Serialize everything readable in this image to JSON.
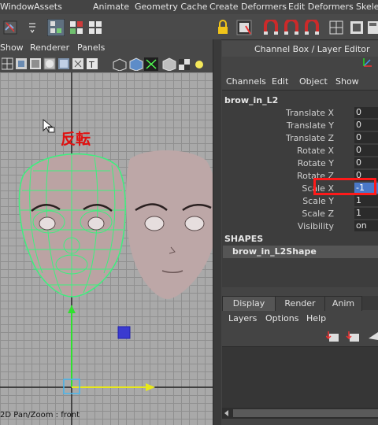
{
  "menubar": {
    "items": [
      "Window",
      "Assets",
      "Animate",
      "Geometry Cache",
      "Create Deformers",
      "Edit Deformers",
      "Skelet"
    ]
  },
  "viewport": {
    "menu": [
      "Show",
      "Renderer",
      "Panels"
    ],
    "annotation": "反転",
    "status": "2D Pan/Zoom : front"
  },
  "channel_box": {
    "title": "Channel Box / Layer Editor",
    "menu": [
      "Channels",
      "Edit",
      "Object",
      "Show"
    ],
    "object_name": "brow_in_L2",
    "attributes": [
      {
        "label": "Translate X",
        "value": "0"
      },
      {
        "label": "Translate Y",
        "value": "0"
      },
      {
        "label": "Translate Z",
        "value": "0"
      },
      {
        "label": "Rotate X",
        "value": "0"
      },
      {
        "label": "Rotate Y",
        "value": "0"
      },
      {
        "label": "Rotate Z",
        "value": "0"
      },
      {
        "label": "Scale X",
        "value": "-1"
      },
      {
        "label": "Scale Y",
        "value": "1"
      },
      {
        "label": "Scale Z",
        "value": "1"
      },
      {
        "label": "Visibility",
        "value": "on"
      }
    ],
    "shapes_label": "SHAPES",
    "shape_name": "brow_in_L2Shape"
  },
  "layer_editor": {
    "tabs": [
      "Display",
      "Render",
      "Anim"
    ],
    "menu": [
      "Layers",
      "Options",
      "Help"
    ]
  },
  "colors": {
    "highlight_box": "#ff1a1a",
    "selected_value": "#4a78c8",
    "wireframe": "#36f07a",
    "annotation": "#e01010"
  }
}
